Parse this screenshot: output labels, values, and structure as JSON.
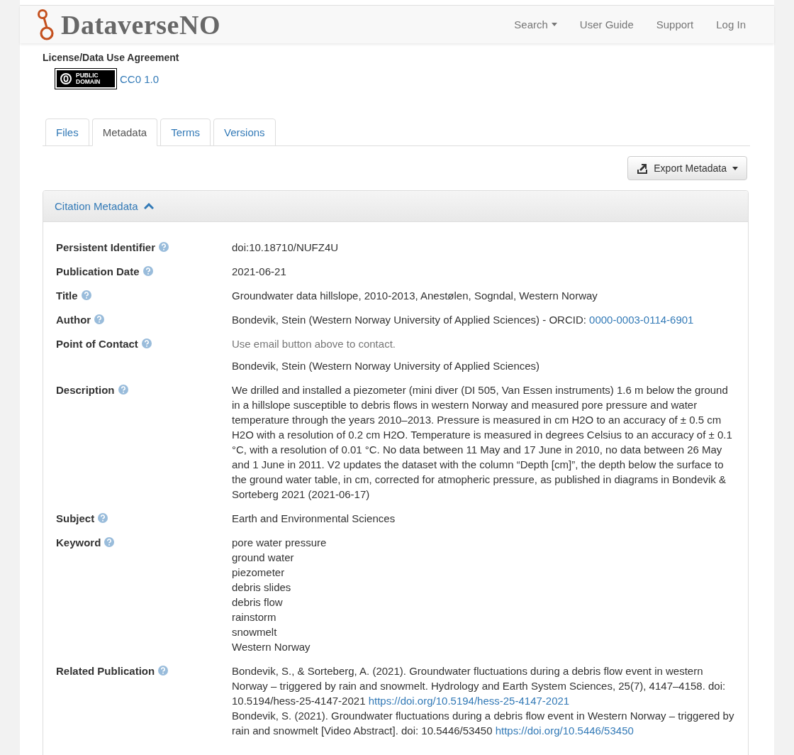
{
  "header": {
    "brand": "DataverseNO",
    "nav": [
      {
        "label": "Search",
        "dropdown": true
      },
      {
        "label": "User Guide",
        "dropdown": false
      },
      {
        "label": "Support",
        "dropdown": false
      },
      {
        "label": "Log In",
        "dropdown": false
      }
    ]
  },
  "license": {
    "heading": "License/Data Use Agreement",
    "badge_top": "PUBLIC",
    "badge_bottom": "DOMAIN",
    "link": "CC0 1.0"
  },
  "tabs": [
    {
      "label": "Files",
      "selected": false
    },
    {
      "label": "Metadata",
      "selected": true
    },
    {
      "label": "Terms",
      "selected": false
    },
    {
      "label": "Versions",
      "selected": false
    }
  ],
  "export_button": {
    "label": "Export Metadata"
  },
  "panel": {
    "title": "Citation Metadata",
    "expanded": true,
    "fields": [
      {
        "label": "Persistent Identifier",
        "paragraphs": [
          [
            {
              "kind": "text",
              "text": "doi:10.18710/NUFZ4U"
            }
          ]
        ]
      },
      {
        "label": "Publication Date",
        "paragraphs": [
          [
            {
              "kind": "text",
              "text": "2021-06-21"
            }
          ]
        ]
      },
      {
        "label": "Title",
        "paragraphs": [
          [
            {
              "kind": "text",
              "text": "Groundwater data hillslope, 2010-2013, Anestølen, Sogndal, Western Norway"
            }
          ]
        ]
      },
      {
        "label": "Author",
        "paragraphs": [
          [
            {
              "kind": "text",
              "text": "Bondevik, Stein (Western Norway University of Applied Sciences) - ORCID:"
            },
            {
              "kind": "link",
              "text": "0000-0003-0114-6901"
            }
          ]
        ]
      },
      {
        "label": "Point of Contact",
        "paragraphs": [
          [
            {
              "kind": "muted",
              "text": "Use email button above to contact."
            }
          ],
          [
            {
              "kind": "text",
              "text": "Bondevik, Stein (Western Norway University of Applied Sciences)"
            }
          ]
        ]
      },
      {
        "label": "Description",
        "paragraphs": [
          [
            {
              "kind": "text",
              "text": "We drilled and installed a piezometer (mini diver (DI 505, Van Essen instruments) 1.6 m below the ground in a hillslope susceptible to debris flows in western Norway and measured pore pressure and water temperature through the years 2010–2013. Pressure is measured in cm H2O to an accuracy of ± 0.5 cm H2O with a resolution of 0.2 cm H2O. Temperature is measured in degrees Celsius to an accuracy of ± 0.1 °C, with a resolution of 0.01 °C. No data between 11 May and 17 June in 2010, no data between 26 May and 1 June in 2011. V2 updates the dataset with the column “Depth [cm]”, the depth below the surface to the ground water table, in cm, corrected for atmopheric pressure, as published in diagrams in Bondevik & Sorteberg 2021 (2021-06-17)"
            }
          ]
        ]
      },
      {
        "label": "Subject",
        "paragraphs": [
          [
            {
              "kind": "text",
              "text": "Earth and Environmental Sciences"
            }
          ]
        ]
      },
      {
        "label": "Keyword",
        "lines": [
          "pore water pressure",
          "ground water",
          "piezometer",
          "debris slides",
          "debris flow",
          "rainstorm",
          "snowmelt",
          "Western Norway"
        ]
      },
      {
        "label": "Related Publication",
        "paragraphs": [
          [
            {
              "kind": "text",
              "text": "Bondevik, S., & Sorteberg, A. (2021). Groundwater fluctuations during a debris flow event in western Norway – triggered by rain and snowmelt. Hydrology and Earth System Sciences, 25(7), 4147–4158. doi: 10.5194/hess-25-4147-2021"
            },
            {
              "kind": "link",
              "text": "https://doi.org/10.5194/hess-25-4147-2021"
            }
          ],
          [
            {
              "kind": "text",
              "text": "Bondevik, S. (2021). Groundwater fluctuations during a debris flow event in Western Norway – triggered by rain and snowmelt [Video Abstract]. doi: 10.5446/53450"
            },
            {
              "kind": "link",
              "text": "https://doi.org/10.5446/53450"
            }
          ]
        ]
      }
    ]
  }
}
